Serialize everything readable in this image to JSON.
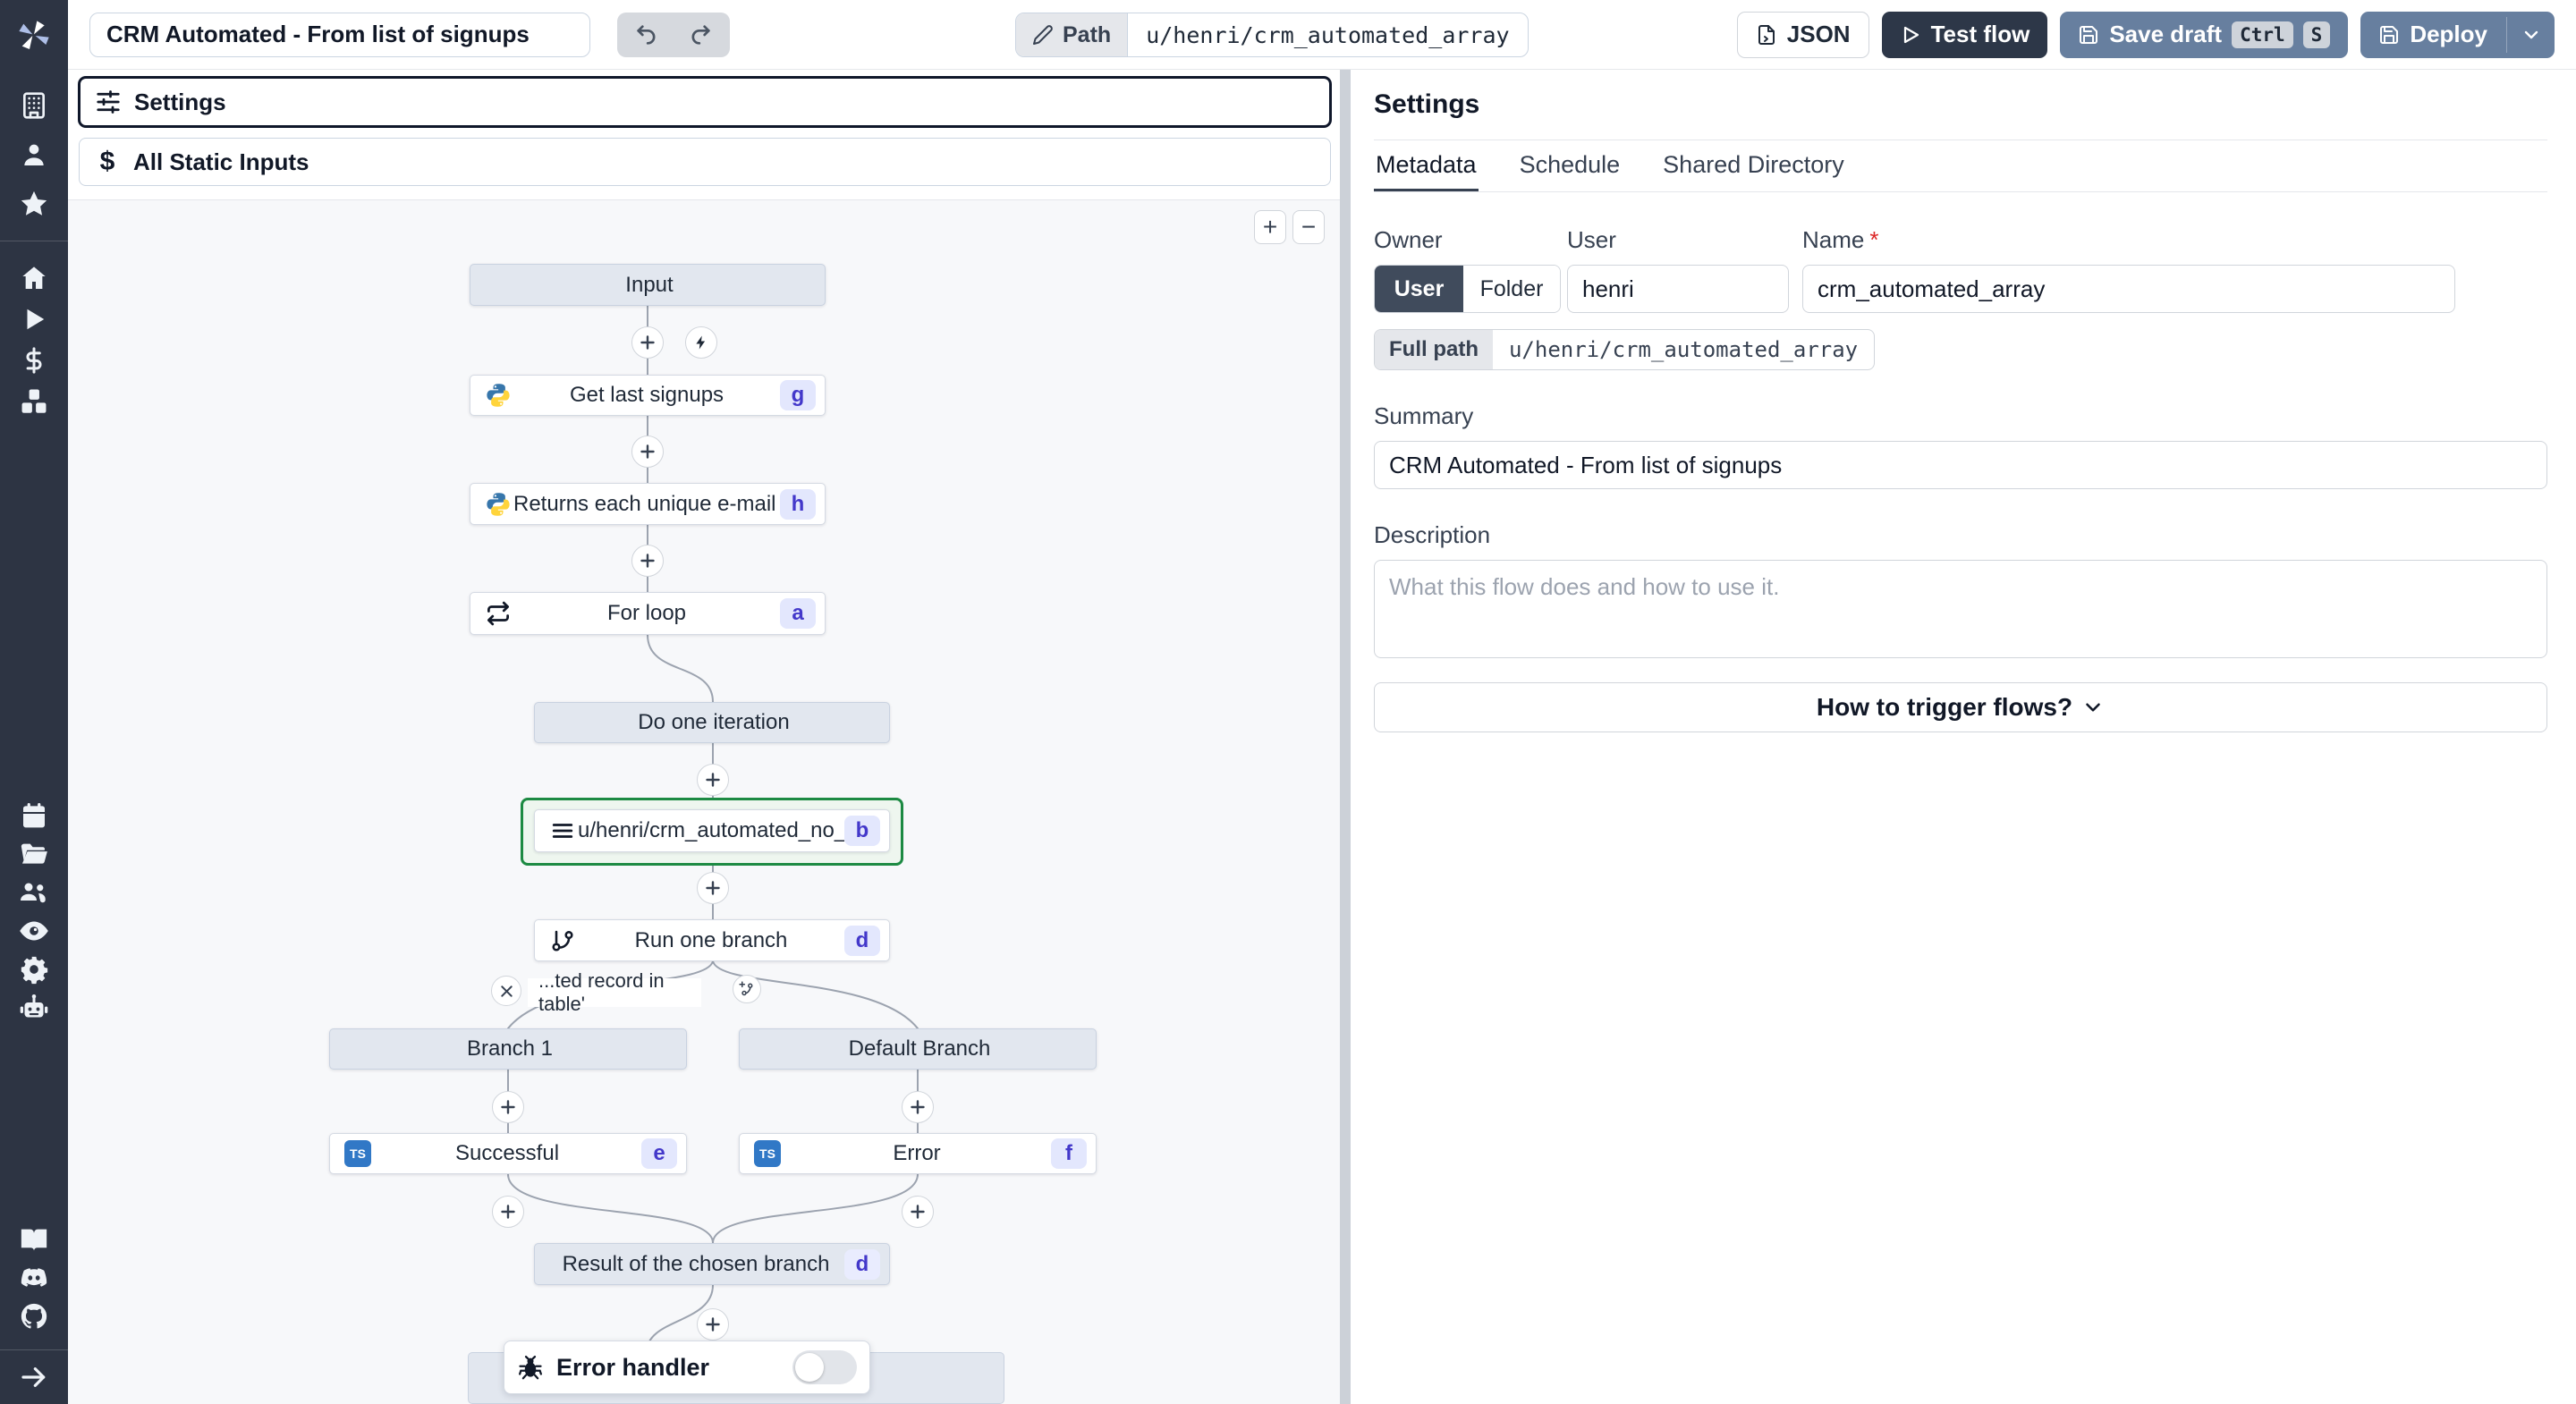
{
  "colors": {
    "sidebar_bg": "#2d3443",
    "accent_selected_green": "#1d8a43",
    "slate_button": "#677f9f",
    "dark_button": "#2d3748",
    "badge_bg": "#e3e7fd",
    "badge_text": "#4338ca",
    "ts_blue": "#3178c6",
    "canvas_bg": "#f7f8fa"
  },
  "topbar": {
    "title_value": "CRM Automated - From list of signups",
    "path_label": "Path",
    "path_value": "u/henri/crm_automated_array",
    "json_button": "JSON",
    "test_flow_button": "Test flow",
    "save_draft_button": "Save draft",
    "kbd_ctrl": "Ctrl",
    "kbd_s": "S",
    "deploy_button": "Deploy"
  },
  "canvas": {
    "settings_module": "Settings",
    "static_inputs_module": "All Static Inputs",
    "zoom_in": "+",
    "zoom_out": "−",
    "ts_label": "TS",
    "nodes": {
      "input": {
        "label": "Input"
      },
      "get_signups": {
        "label": "Get last signups",
        "badge": "g"
      },
      "unique_emails": {
        "label": "Returns each unique e-mail in an array",
        "badge": "h"
      },
      "for_loop": {
        "label": "For loop",
        "badge": "a"
      },
      "iteration": {
        "label": "Do one iteration"
      },
      "crm_script": {
        "label": "u/henri/crm_automated_no_human",
        "badge": "b"
      },
      "run_one_branch": {
        "label": "Run one branch",
        "badge": "d"
      },
      "branch_condition": {
        "label": "...ted record in table'"
      },
      "branch1": {
        "label": "Branch 1"
      },
      "default_branch": {
        "label": "Default Branch"
      },
      "successful": {
        "label": "Successful",
        "badge": "e"
      },
      "error": {
        "label": "Error",
        "badge": "f"
      },
      "result": {
        "label": "Result of the chosen branch",
        "badge": "d"
      },
      "error_handler": {
        "label": "Error handler"
      }
    }
  },
  "panel": {
    "heading": "Settings",
    "tabs": [
      "Metadata",
      "Schedule",
      "Shared Directory"
    ],
    "owner_label": "Owner",
    "owner_user": "User",
    "owner_folder": "Folder",
    "user_label": "User",
    "user_value": "henri",
    "name_label": "Name",
    "name_required": "*",
    "name_value": "crm_automated_array",
    "full_path_label": "Full path",
    "full_path_value": "u/henri/crm_automated_array",
    "summary_label": "Summary",
    "summary_value": "CRM Automated - From list of signups",
    "description_label": "Description",
    "description_placeholder": "What this flow does and how to use it.",
    "trigger_button": "How to trigger flows?"
  }
}
